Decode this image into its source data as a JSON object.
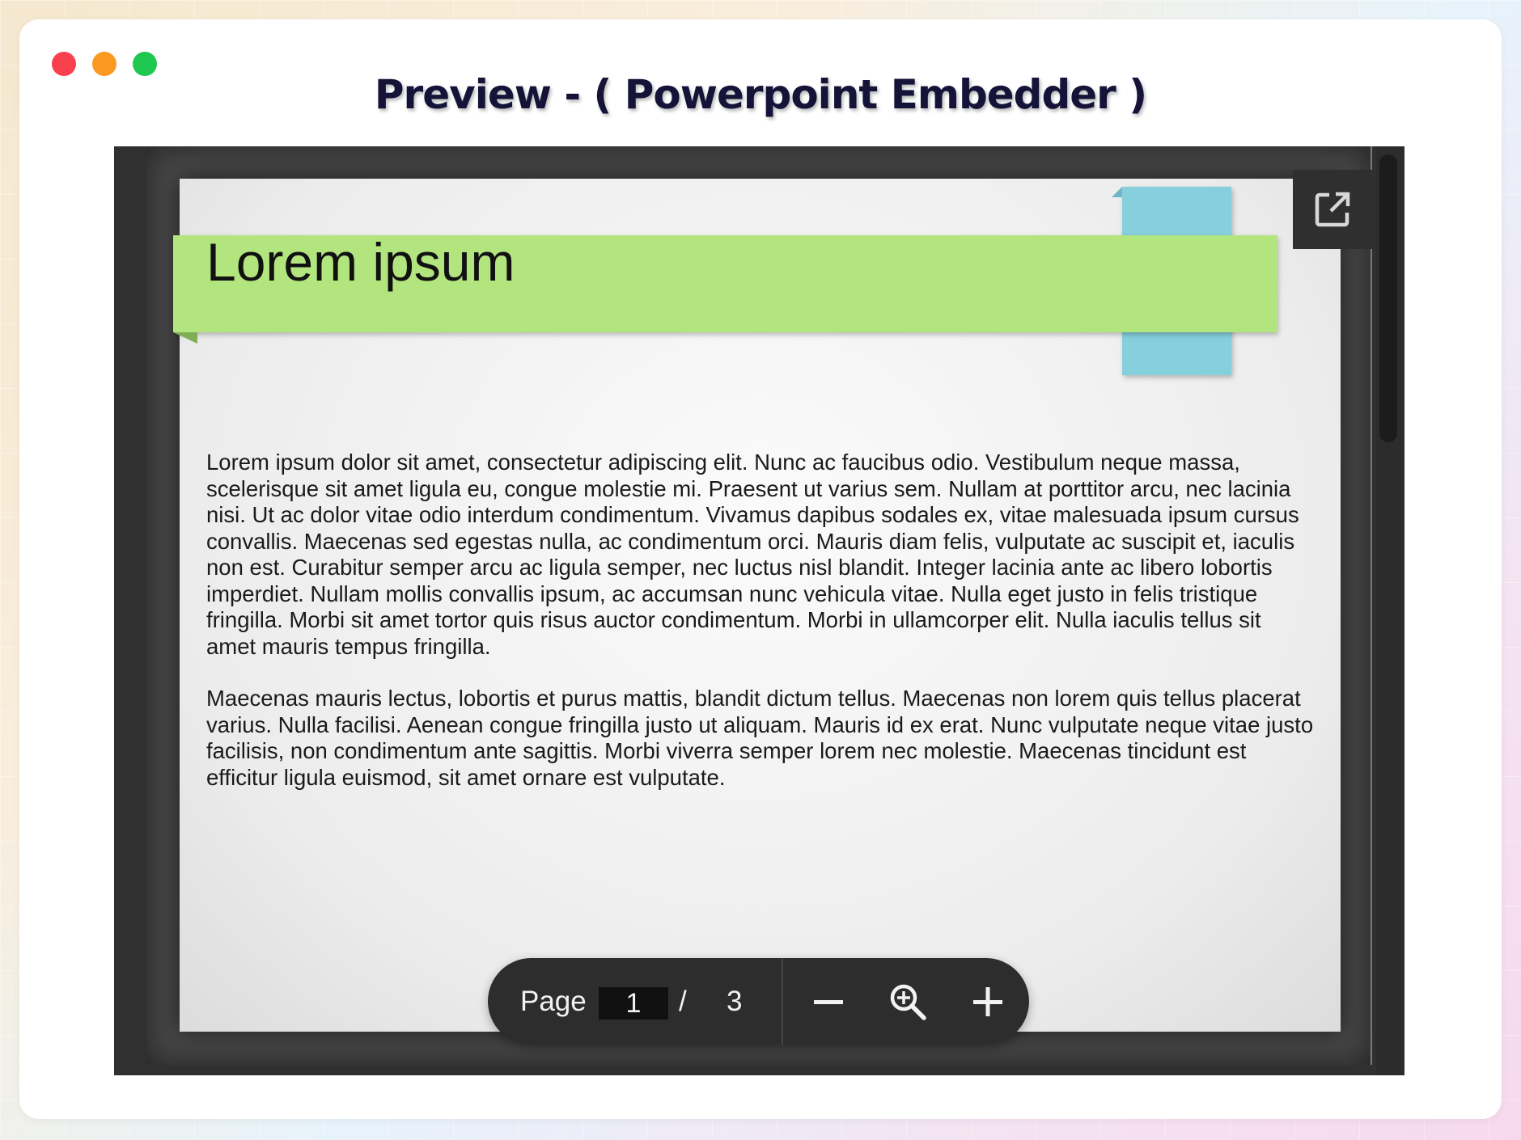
{
  "window": {
    "title": "Preview - ( Powerpoint Embedder )"
  },
  "slide": {
    "title": "Lorem ipsum",
    "paragraphs": [
      "Lorem ipsum dolor sit amet, consectetur adipiscing elit. Nunc ac faucibus odio. Vestibulum neque massa, scelerisque sit amet ligula eu, congue molestie mi. Praesent ut varius sem. Nullam at porttitor arcu, nec lacinia nisi. Ut ac dolor vitae odio interdum condimentum. Vivamus dapibus sodales ex, vitae malesuada ipsum cursus convallis. Maecenas sed egestas nulla, ac condimentum orci. Mauris diam felis, vulputate ac suscipit et, iaculis non est. Curabitur semper arcu ac ligula semper, nec luctus nisl blandit. Integer lacinia ante ac libero lobortis imperdiet. Nullam mollis convallis ipsum, ac accumsan nunc vehicula vitae. Nulla eget justo in felis tristique fringilla. Morbi sit amet tortor quis risus auctor condimentum. Morbi in ullamcorper elit. Nulla iaculis tellus sit amet mauris tempus fringilla.",
      "Maecenas mauris lectus, lobortis et purus mattis, blandit dictum tellus. Maecenas non lorem quis tellus placerat varius. Nulla facilisi. Aenean congue fringilla justo ut aliquam. Mauris id ex erat. Nunc vulputate neque vitae justo facilisis, non condimentum ante sagittis. Morbi viverra semper lorem nec molestie. Maecenas tincidunt est efficitur ligula euismod, sit amet ornare est vulputate."
    ],
    "colors": {
      "banner": "#b3e57f",
      "tab": "#86d0de"
    }
  },
  "toolbar": {
    "page_label": "Page",
    "current_page": "1",
    "separator": "/",
    "total_pages": "3",
    "icons": [
      "zoom-out-icon",
      "zoom-reset-icon",
      "zoom-in-icon"
    ]
  },
  "popout": {
    "icon": "open-external-icon"
  },
  "colors": {
    "traffic_red": "#f8404c",
    "traffic_yellow": "#f99922",
    "traffic_green": "#1ec74f",
    "title": "#151338"
  }
}
